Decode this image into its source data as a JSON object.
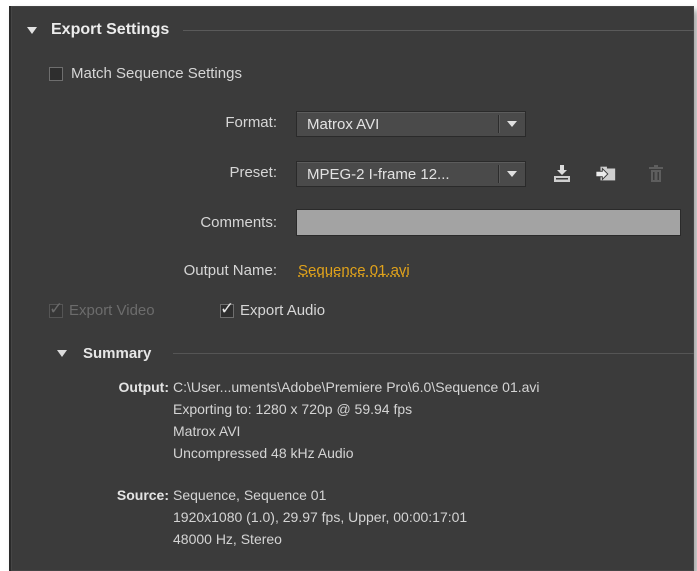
{
  "section": {
    "title": "Export Settings"
  },
  "match_sequence": {
    "label": "Match Sequence Settings",
    "checked": false
  },
  "format": {
    "label": "Format:",
    "value": "Matrox AVI"
  },
  "preset": {
    "label": "Preset:",
    "value": "MPEG-2 I-frame 12...",
    "icons": [
      "save-preset-icon",
      "import-preset-icon",
      "delete-preset-icon"
    ]
  },
  "comments": {
    "label": "Comments:",
    "value": ""
  },
  "output_name": {
    "label": "Output Name:",
    "value": "Sequence 01.avi"
  },
  "export_video": {
    "label": "Export Video",
    "checked": true,
    "enabled": false
  },
  "export_audio": {
    "label": "Export Audio",
    "checked": true,
    "enabled": true
  },
  "summary": {
    "title": "Summary",
    "output": {
      "key": "Output:",
      "lines": [
        "C:\\User...uments\\Adobe\\Premiere Pro\\6.0\\Sequence 01.avi",
        "Exporting to: 1280 x 720p @ 59.94 fps",
        "Matrox AVI",
        "Uncompressed 48 kHz Audio"
      ]
    },
    "source": {
      "key": "Source:",
      "lines": [
        "Sequence, Sequence 01",
        "1920x1080 (1.0), 29.97 fps, Upper, 00:00:17:01",
        "48000 Hz, Stereo"
      ]
    }
  },
  "colors": {
    "panel_bg": "#3b3b3b",
    "link": "#e0a21b",
    "field_bg": "#a3a3a3"
  }
}
